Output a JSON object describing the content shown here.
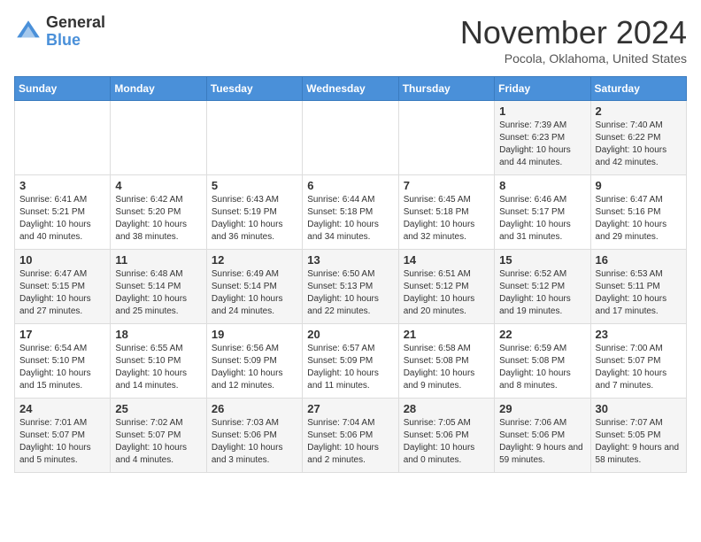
{
  "header": {
    "logo_general": "General",
    "logo_blue": "Blue",
    "month_title": "November 2024",
    "location": "Pocola, Oklahoma, United States"
  },
  "weekdays": [
    "Sunday",
    "Monday",
    "Tuesday",
    "Wednesday",
    "Thursday",
    "Friday",
    "Saturday"
  ],
  "weeks": [
    [
      {
        "day": "",
        "sunrise": "",
        "sunset": "",
        "daylight": ""
      },
      {
        "day": "",
        "sunrise": "",
        "sunset": "",
        "daylight": ""
      },
      {
        "day": "",
        "sunrise": "",
        "sunset": "",
        "daylight": ""
      },
      {
        "day": "",
        "sunrise": "",
        "sunset": "",
        "daylight": ""
      },
      {
        "day": "",
        "sunrise": "",
        "sunset": "",
        "daylight": ""
      },
      {
        "day": "1",
        "sunrise": "Sunrise: 7:39 AM",
        "sunset": "Sunset: 6:23 PM",
        "daylight": "Daylight: 10 hours and 44 minutes."
      },
      {
        "day": "2",
        "sunrise": "Sunrise: 7:40 AM",
        "sunset": "Sunset: 6:22 PM",
        "daylight": "Daylight: 10 hours and 42 minutes."
      }
    ],
    [
      {
        "day": "3",
        "sunrise": "Sunrise: 6:41 AM",
        "sunset": "Sunset: 5:21 PM",
        "daylight": "Daylight: 10 hours and 40 minutes."
      },
      {
        "day": "4",
        "sunrise": "Sunrise: 6:42 AM",
        "sunset": "Sunset: 5:20 PM",
        "daylight": "Daylight: 10 hours and 38 minutes."
      },
      {
        "day": "5",
        "sunrise": "Sunrise: 6:43 AM",
        "sunset": "Sunset: 5:19 PM",
        "daylight": "Daylight: 10 hours and 36 minutes."
      },
      {
        "day": "6",
        "sunrise": "Sunrise: 6:44 AM",
        "sunset": "Sunset: 5:18 PM",
        "daylight": "Daylight: 10 hours and 34 minutes."
      },
      {
        "day": "7",
        "sunrise": "Sunrise: 6:45 AM",
        "sunset": "Sunset: 5:18 PM",
        "daylight": "Daylight: 10 hours and 32 minutes."
      },
      {
        "day": "8",
        "sunrise": "Sunrise: 6:46 AM",
        "sunset": "Sunset: 5:17 PM",
        "daylight": "Daylight: 10 hours and 31 minutes."
      },
      {
        "day": "9",
        "sunrise": "Sunrise: 6:47 AM",
        "sunset": "Sunset: 5:16 PM",
        "daylight": "Daylight: 10 hours and 29 minutes."
      }
    ],
    [
      {
        "day": "10",
        "sunrise": "Sunrise: 6:47 AM",
        "sunset": "Sunset: 5:15 PM",
        "daylight": "Daylight: 10 hours and 27 minutes."
      },
      {
        "day": "11",
        "sunrise": "Sunrise: 6:48 AM",
        "sunset": "Sunset: 5:14 PM",
        "daylight": "Daylight: 10 hours and 25 minutes."
      },
      {
        "day": "12",
        "sunrise": "Sunrise: 6:49 AM",
        "sunset": "Sunset: 5:14 PM",
        "daylight": "Daylight: 10 hours and 24 minutes."
      },
      {
        "day": "13",
        "sunrise": "Sunrise: 6:50 AM",
        "sunset": "Sunset: 5:13 PM",
        "daylight": "Daylight: 10 hours and 22 minutes."
      },
      {
        "day": "14",
        "sunrise": "Sunrise: 6:51 AM",
        "sunset": "Sunset: 5:12 PM",
        "daylight": "Daylight: 10 hours and 20 minutes."
      },
      {
        "day": "15",
        "sunrise": "Sunrise: 6:52 AM",
        "sunset": "Sunset: 5:12 PM",
        "daylight": "Daylight: 10 hours and 19 minutes."
      },
      {
        "day": "16",
        "sunrise": "Sunrise: 6:53 AM",
        "sunset": "Sunset: 5:11 PM",
        "daylight": "Daylight: 10 hours and 17 minutes."
      }
    ],
    [
      {
        "day": "17",
        "sunrise": "Sunrise: 6:54 AM",
        "sunset": "Sunset: 5:10 PM",
        "daylight": "Daylight: 10 hours and 15 minutes."
      },
      {
        "day": "18",
        "sunrise": "Sunrise: 6:55 AM",
        "sunset": "Sunset: 5:10 PM",
        "daylight": "Daylight: 10 hours and 14 minutes."
      },
      {
        "day": "19",
        "sunrise": "Sunrise: 6:56 AM",
        "sunset": "Sunset: 5:09 PM",
        "daylight": "Daylight: 10 hours and 12 minutes."
      },
      {
        "day": "20",
        "sunrise": "Sunrise: 6:57 AM",
        "sunset": "Sunset: 5:09 PM",
        "daylight": "Daylight: 10 hours and 11 minutes."
      },
      {
        "day": "21",
        "sunrise": "Sunrise: 6:58 AM",
        "sunset": "Sunset: 5:08 PM",
        "daylight": "Daylight: 10 hours and 9 minutes."
      },
      {
        "day": "22",
        "sunrise": "Sunrise: 6:59 AM",
        "sunset": "Sunset: 5:08 PM",
        "daylight": "Daylight: 10 hours and 8 minutes."
      },
      {
        "day": "23",
        "sunrise": "Sunrise: 7:00 AM",
        "sunset": "Sunset: 5:07 PM",
        "daylight": "Daylight: 10 hours and 7 minutes."
      }
    ],
    [
      {
        "day": "24",
        "sunrise": "Sunrise: 7:01 AM",
        "sunset": "Sunset: 5:07 PM",
        "daylight": "Daylight: 10 hours and 5 minutes."
      },
      {
        "day": "25",
        "sunrise": "Sunrise: 7:02 AM",
        "sunset": "Sunset: 5:07 PM",
        "daylight": "Daylight: 10 hours and 4 minutes."
      },
      {
        "day": "26",
        "sunrise": "Sunrise: 7:03 AM",
        "sunset": "Sunset: 5:06 PM",
        "daylight": "Daylight: 10 hours and 3 minutes."
      },
      {
        "day": "27",
        "sunrise": "Sunrise: 7:04 AM",
        "sunset": "Sunset: 5:06 PM",
        "daylight": "Daylight: 10 hours and 2 minutes."
      },
      {
        "day": "28",
        "sunrise": "Sunrise: 7:05 AM",
        "sunset": "Sunset: 5:06 PM",
        "daylight": "Daylight: 10 hours and 0 minutes."
      },
      {
        "day": "29",
        "sunrise": "Sunrise: 7:06 AM",
        "sunset": "Sunset: 5:06 PM",
        "daylight": "Daylight: 9 hours and 59 minutes."
      },
      {
        "day": "30",
        "sunrise": "Sunrise: 7:07 AM",
        "sunset": "Sunset: 5:05 PM",
        "daylight": "Daylight: 9 hours and 58 minutes."
      }
    ]
  ]
}
